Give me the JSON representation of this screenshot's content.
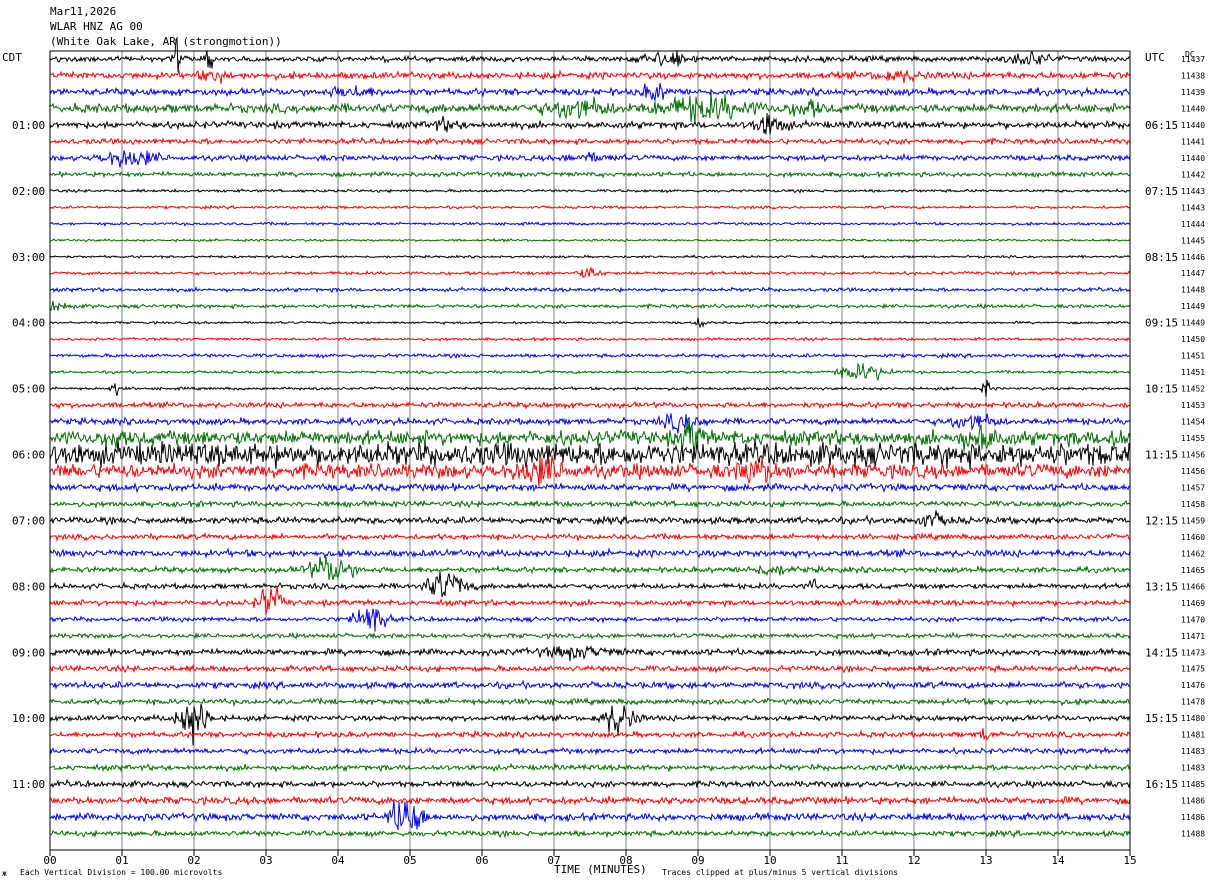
{
  "header": {
    "date": "Mar11,2026",
    "station": "WLAR HNZ AG 00",
    "location": "(White Oak Lake, AR (strongmotion))"
  },
  "left_axis_label": "CDT",
  "right_axis_label": "UTC",
  "dc_header": "DC",
  "footer": {
    "division_note": "Each Vertical Division =  100.00 microvolts",
    "clip_note": "Traces clipped at plus/minus 5 vertical divisions",
    "corner_mark": "ж"
  },
  "colors": {
    "cycle": [
      "#000000",
      "#ff0000",
      "#0000ff",
      "#007000"
    ],
    "grid": "#808080",
    "frame": "#000000"
  },
  "chart_data": {
    "type": "line",
    "subtype": "helicorder",
    "xlabel": "TIME (MINUTES)",
    "xlim": [
      0,
      15
    ],
    "x_ticks": [
      "00",
      "01",
      "02",
      "03",
      "04",
      "05",
      "06",
      "07",
      "08",
      "09",
      "10",
      "11",
      "12",
      "13",
      "14",
      "15"
    ],
    "rows_per_hour": 4,
    "minutes_per_row": 15,
    "left_hour_labels": [
      "01:00",
      "02:00",
      "03:00",
      "04:00",
      "05:00",
      "06:00",
      "07:00",
      "08:00",
      "09:00",
      "10:00",
      "11:00"
    ],
    "right_hour_labels": [
      "06:15",
      "07:15",
      "08:15",
      "09:15",
      "10:15",
      "11:15",
      "12:15",
      "13:15",
      "14:15",
      "15:15",
      "16:15"
    ],
    "dc_offsets": [
      "11437",
      "11438",
      "11439",
      "11440",
      "11440",
      "11441",
      "11440",
      "11442",
      "11443",
      "11443",
      "11444",
      "11445",
      "11446",
      "11447",
      "11448",
      "11449",
      "11449",
      "11450",
      "11451",
      "11451",
      "11452",
      "11453",
      "11454",
      "11455",
      "11456",
      "11456",
      "11457",
      "11458",
      "11459",
      "11460",
      "11462",
      "11465",
      "11466",
      "11469",
      "11470",
      "11471",
      "11473",
      "11475",
      "11476",
      "11478",
      "11480",
      "11481",
      "11483",
      "11483",
      "11485",
      "11486",
      "11486",
      "11488"
    ],
    "row_noise": [
      1.2,
      1.5,
      1.5,
      2.0,
      1.5,
      1.2,
      1.2,
      1.0,
      0.6,
      0.6,
      0.6,
      0.5,
      0.5,
      0.7,
      0.8,
      0.8,
      0.5,
      0.6,
      0.8,
      0.6,
      0.6,
      1.2,
      1.4,
      3.2,
      5.2,
      3.2,
      1.6,
      1.2,
      1.5,
      1.2,
      1.5,
      1.2,
      1.2,
      1.2,
      1.0,
      1.0,
      1.4,
      1.3,
      1.4,
      1.2,
      1.2,
      1.2,
      1.2,
      1.2,
      1.3,
      1.6,
      1.6,
      1.2
    ],
    "events": [
      {
        "row": 0,
        "minute": 1.75,
        "amp": 8,
        "width": 0.04
      },
      {
        "row": 0,
        "minute": 2.2,
        "amp": 10,
        "width": 0.05
      },
      {
        "row": 0,
        "minute": 8.6,
        "amp": 3,
        "width": 0.3
      },
      {
        "row": 0,
        "minute": 13.6,
        "amp": 3,
        "width": 0.25
      },
      {
        "row": 1,
        "minute": 2.3,
        "amp": 2,
        "width": 0.2
      },
      {
        "row": 1,
        "minute": 11.8,
        "amp": 2,
        "width": 0.3
      },
      {
        "row": 2,
        "minute": 4.2,
        "amp": 2,
        "width": 0.3
      },
      {
        "row": 2,
        "minute": 8.4,
        "amp": 4,
        "width": 0.15
      },
      {
        "row": 3,
        "minute": 7.3,
        "amp": 4,
        "width": 0.4
      },
      {
        "row": 3,
        "minute": 9.1,
        "amp": 5,
        "width": 0.6
      },
      {
        "row": 3,
        "minute": 10.5,
        "amp": 3,
        "width": 0.2
      },
      {
        "row": 4,
        "minute": 5.5,
        "amp": 2,
        "width": 0.2
      },
      {
        "row": 4,
        "minute": 10.0,
        "amp": 5,
        "width": 0.2
      },
      {
        "row": 6,
        "minute": 1.1,
        "amp": 4,
        "width": 0.35
      },
      {
        "row": 6,
        "minute": 7.5,
        "amp": 1.5,
        "width": 0.3
      },
      {
        "row": 13,
        "minute": 7.5,
        "amp": 2.5,
        "width": 0.15
      },
      {
        "row": 15,
        "minute": 0.1,
        "amp": 2.5,
        "width": 0.15
      },
      {
        "row": 16,
        "minute": 9.05,
        "amp": 5,
        "width": 0.05
      },
      {
        "row": 19,
        "minute": 11.3,
        "amp": 4,
        "width": 0.3
      },
      {
        "row": 20,
        "minute": 0.9,
        "amp": 6,
        "width": 0.04
      },
      {
        "row": 20,
        "minute": 13.0,
        "amp": 6,
        "width": 0.04
      },
      {
        "row": 22,
        "minute": 8.8,
        "amp": 4,
        "width": 0.25
      },
      {
        "row": 22,
        "minute": 12.8,
        "amp": 3,
        "width": 0.3
      },
      {
        "row": 23,
        "minute": 0.9,
        "amp": 5,
        "width": 0.05
      },
      {
        "row": 23,
        "minute": 8.9,
        "amp": 6,
        "width": 0.15
      },
      {
        "row": 23,
        "minute": 12.9,
        "amp": 5,
        "width": 0.2
      },
      {
        "row": 23,
        "minute": 14.8,
        "amp": 4,
        "width": 0.1
      },
      {
        "row": 25,
        "minute": 6.8,
        "amp": 5,
        "width": 0.3
      },
      {
        "row": 25,
        "minute": 9.8,
        "amp": 5,
        "width": 0.2
      },
      {
        "row": 28,
        "minute": 12.25,
        "amp": 2.5,
        "width": 0.25
      },
      {
        "row": 31,
        "minute": 3.9,
        "amp": 6,
        "width": 0.3
      },
      {
        "row": 31,
        "minute": 10.0,
        "amp": 2,
        "width": 0.3
      },
      {
        "row": 32,
        "minute": 5.5,
        "amp": 7,
        "width": 0.25
      },
      {
        "row": 32,
        "minute": 10.6,
        "amp": 4,
        "width": 0.05
      },
      {
        "row": 33,
        "minute": 3.05,
        "amp": 8,
        "width": 0.15
      },
      {
        "row": 34,
        "minute": 4.45,
        "amp": 7,
        "width": 0.2
      },
      {
        "row": 36,
        "minute": 7.3,
        "amp": 2,
        "width": 0.5
      },
      {
        "row": 40,
        "minute": 2.0,
        "amp": 10,
        "width": 0.2
      },
      {
        "row": 40,
        "minute": 7.9,
        "amp": 8,
        "width": 0.2
      },
      {
        "row": 41,
        "minute": 13.0,
        "amp": 3,
        "width": 0.08
      },
      {
        "row": 46,
        "minute": 4.95,
        "amp": 10,
        "width": 0.2
      }
    ]
  }
}
